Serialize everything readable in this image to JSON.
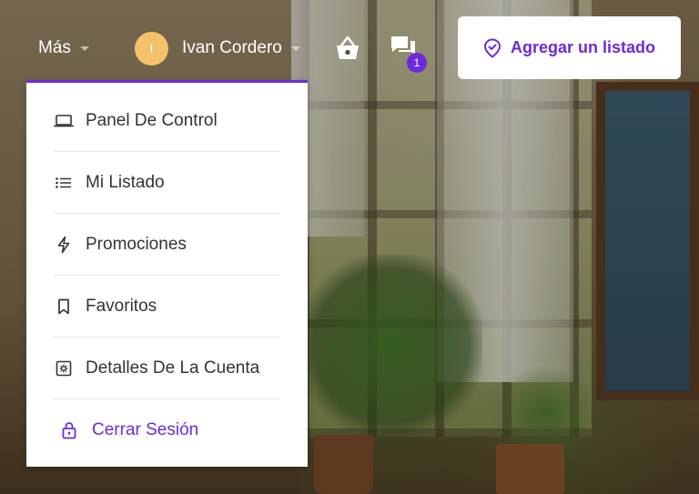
{
  "nav": {
    "more_label": "Más",
    "user": {
      "initial": "I",
      "name": "Ivan Cordero"
    },
    "messages_badge": "1",
    "add_listing_label": "Agregar un listado"
  },
  "dropdown": {
    "items": [
      {
        "label": "Panel De Control",
        "icon": "laptop-icon"
      },
      {
        "label": "Mi Listado",
        "icon": "list-icon"
      },
      {
        "label": "Promociones",
        "icon": "lightning-icon"
      },
      {
        "label": "Favoritos",
        "icon": "bookmark-icon"
      },
      {
        "label": "Detalles De La Cuenta",
        "icon": "account-settings-icon"
      }
    ],
    "logout_label": "Cerrar Sesión"
  },
  "colors": {
    "accent": "#6c2bd9",
    "avatar_bg": "#f4c26a",
    "menu_text": "#333333"
  }
}
